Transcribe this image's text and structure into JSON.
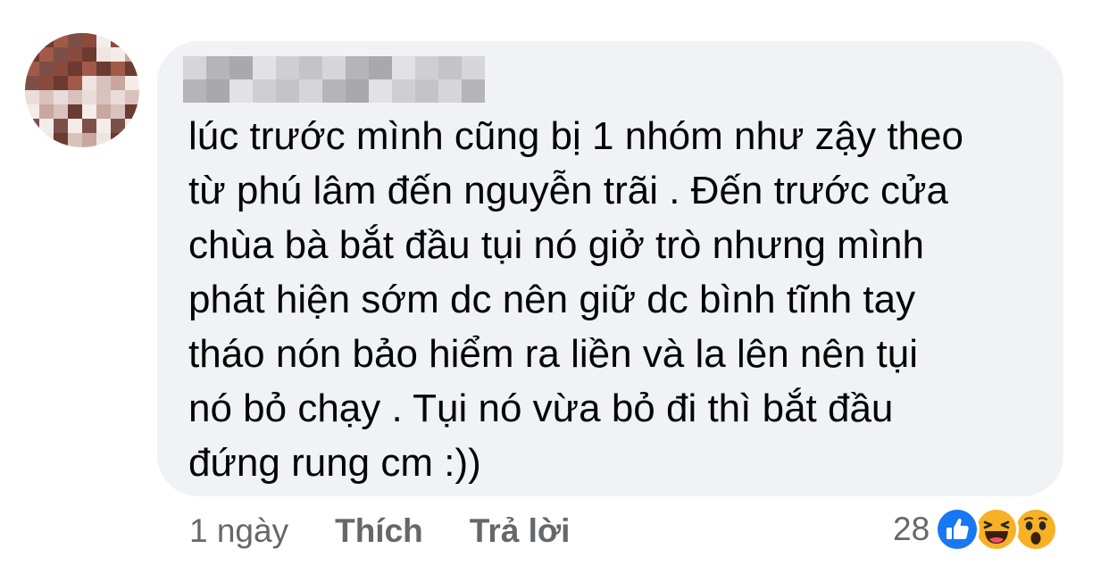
{
  "comment": {
    "text": "lúc trước mình cũng bị 1 nhóm như zậy theo\ntừ phú lâm đến nguyễn trãi . Đến trước cửa\nchùa bà bắt đầu tụi nó giở trò nhưng mình\nphát hiện sớm dc nên giữ dc bình tĩnh tay\ntháo nón bảo hiểm ra liền và la lên nên tụi\nnó bỏ chạy . Tụi nó vừa bỏ đi thì bắt đầu\nđứng rung cm :))",
    "time": "1 ngày",
    "like_label": "Thích",
    "reply_label": "Trả lời",
    "reaction_count": "28",
    "reactions": [
      "like-icon",
      "haha-icon",
      "wow-icon"
    ]
  },
  "colors": {
    "bubble": "#f0f2f5",
    "text": "#050505",
    "meta": "#65676b",
    "like_blue": "#1877f2",
    "emoji_yellow": "#f7b125"
  }
}
